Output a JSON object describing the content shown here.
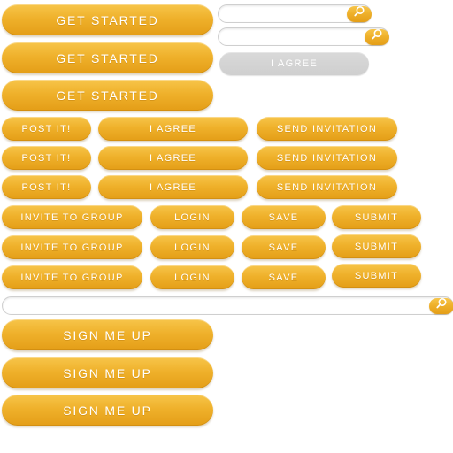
{
  "colors": {
    "accent_top": "#f7c54a",
    "accent_mid": "#efb12b",
    "accent_bottom": "#e49e17",
    "disabled": "#d3d3d3",
    "text": "#ffffff"
  },
  "buttons": {
    "get_started": "GET STARTED",
    "post_it": "POST IT!",
    "i_agree": "I AGREE",
    "send_invitation": "SEND INVITATION",
    "invite_to_group": "INVITE TO GROUP",
    "login": "LOGIN",
    "save": "SAVE",
    "submit": "SUBMIT",
    "sign_me_up": "SIGN ME UP",
    "disabled_agree": "I AGREE"
  },
  "search": {
    "placeholder": "",
    "value": "",
    "icon": "search-icon"
  }
}
